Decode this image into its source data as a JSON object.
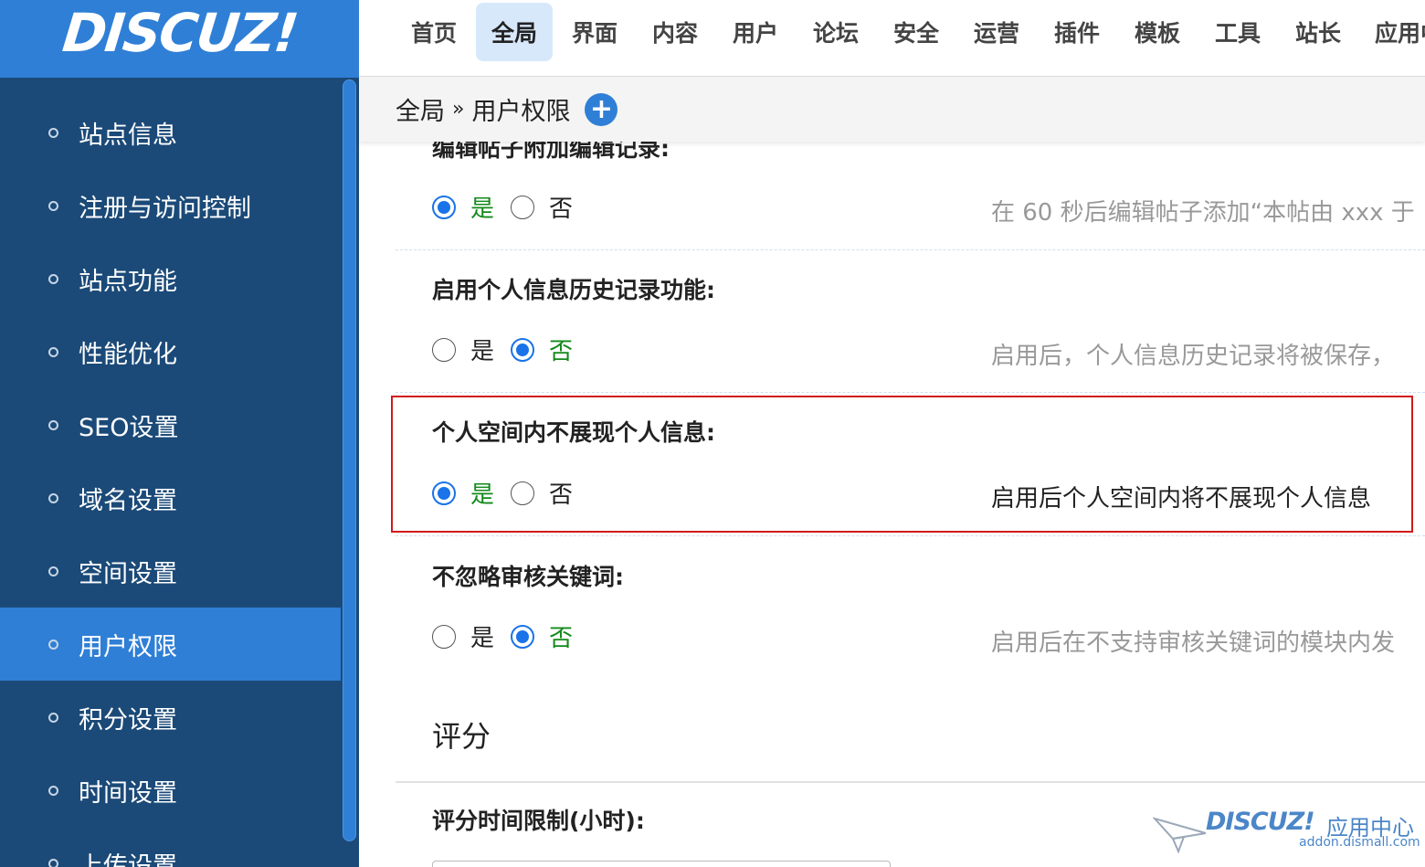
{
  "logo": {
    "text": "DISCUZ!"
  },
  "topnav": {
    "items": [
      {
        "label": "首页",
        "active": false
      },
      {
        "label": "全局",
        "active": true
      },
      {
        "label": "界面",
        "active": false
      },
      {
        "label": "内容",
        "active": false
      },
      {
        "label": "用户",
        "active": false
      },
      {
        "label": "论坛",
        "active": false
      },
      {
        "label": "安全",
        "active": false
      },
      {
        "label": "运营",
        "active": false
      },
      {
        "label": "插件",
        "active": false
      },
      {
        "label": "模板",
        "active": false
      },
      {
        "label": "工具",
        "active": false
      },
      {
        "label": "站长",
        "active": false
      },
      {
        "label": "应用中",
        "active": false
      }
    ]
  },
  "sidebar": {
    "items": [
      {
        "label": "站点信息"
      },
      {
        "label": "注册与访问控制"
      },
      {
        "label": "站点功能"
      },
      {
        "label": "性能优化"
      },
      {
        "label": "SEO设置"
      },
      {
        "label": "域名设置"
      },
      {
        "label": "空间设置"
      },
      {
        "label": "用户权限",
        "active": true
      },
      {
        "label": "积分设置"
      },
      {
        "label": "时间设置"
      },
      {
        "label": "上传设置"
      }
    ]
  },
  "breadcrumb": {
    "parent": "全局",
    "separator": "»",
    "current": "用户权限",
    "add_icon": "+"
  },
  "settings": [
    {
      "title": "编辑帖子附加编辑记录:",
      "yes_label": "是",
      "no_label": "否",
      "selected": "yes",
      "description": "在 60 秒后编辑帖子添加“本帖由 xxx 于"
    },
    {
      "title": "启用个人信息历史记录功能:",
      "yes_label": "是",
      "no_label": "否",
      "selected": "no",
      "description": "启用后，个人信息历史记录将被保存，"
    },
    {
      "title": "个人空间内不展现个人信息:",
      "yes_label": "是",
      "no_label": "否",
      "selected": "yes",
      "description": "启用后个人空间内将不展现个人信息"
    },
    {
      "title": "不忽略审核关键词:",
      "yes_label": "是",
      "no_label": "否",
      "selected": "no",
      "description": "启用后在不支持审核关键词的模块内发"
    }
  ],
  "section": {
    "title": "评分"
  },
  "rating_time": {
    "title": "评分时间限制(小时):"
  },
  "watermark": {
    "brand": "DISCUZ!",
    "center": "应用中心",
    "url": "addon.dismall.com"
  },
  "colors": {
    "accent": "#2f7fd6",
    "sidebar_bg": "#1b4a78",
    "highlight_border": "#d01b1b",
    "selected_text": "#138a1b"
  }
}
